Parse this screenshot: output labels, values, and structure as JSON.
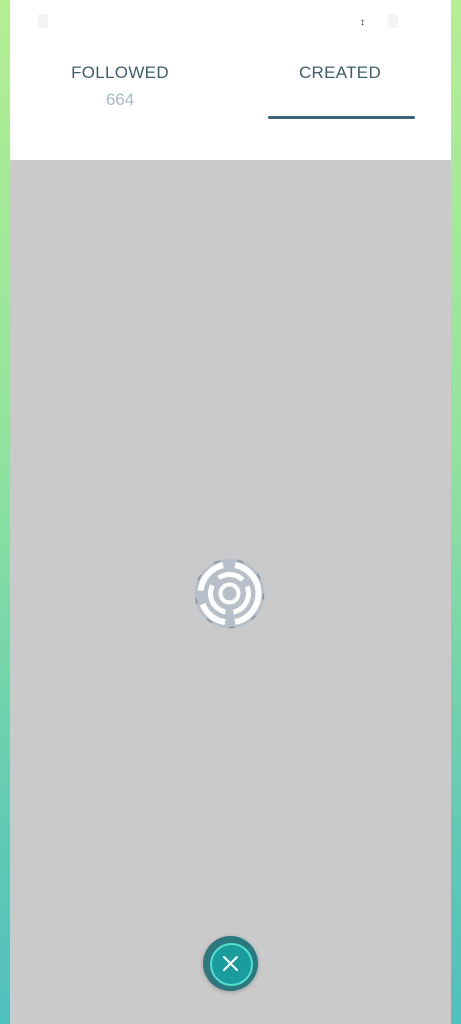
{
  "tabs": [
    {
      "label": "FOLLOWED",
      "count": "664",
      "selected": false
    },
    {
      "label": "CREATED",
      "selected": true
    }
  ],
  "status_bar": {
    "glyph": "↕"
  },
  "loading": {
    "icon": "loading-spinner-icon"
  },
  "close_button": {
    "icon": "close-icon"
  },
  "colors": {
    "tab_text": "#3d5f6c",
    "count_text": "#a7bcc2",
    "indicator": "#3d6474",
    "content_background": "#cacaca",
    "fab_fill": "#1a9b9c",
    "fab_ring": "#51e0cf"
  }
}
